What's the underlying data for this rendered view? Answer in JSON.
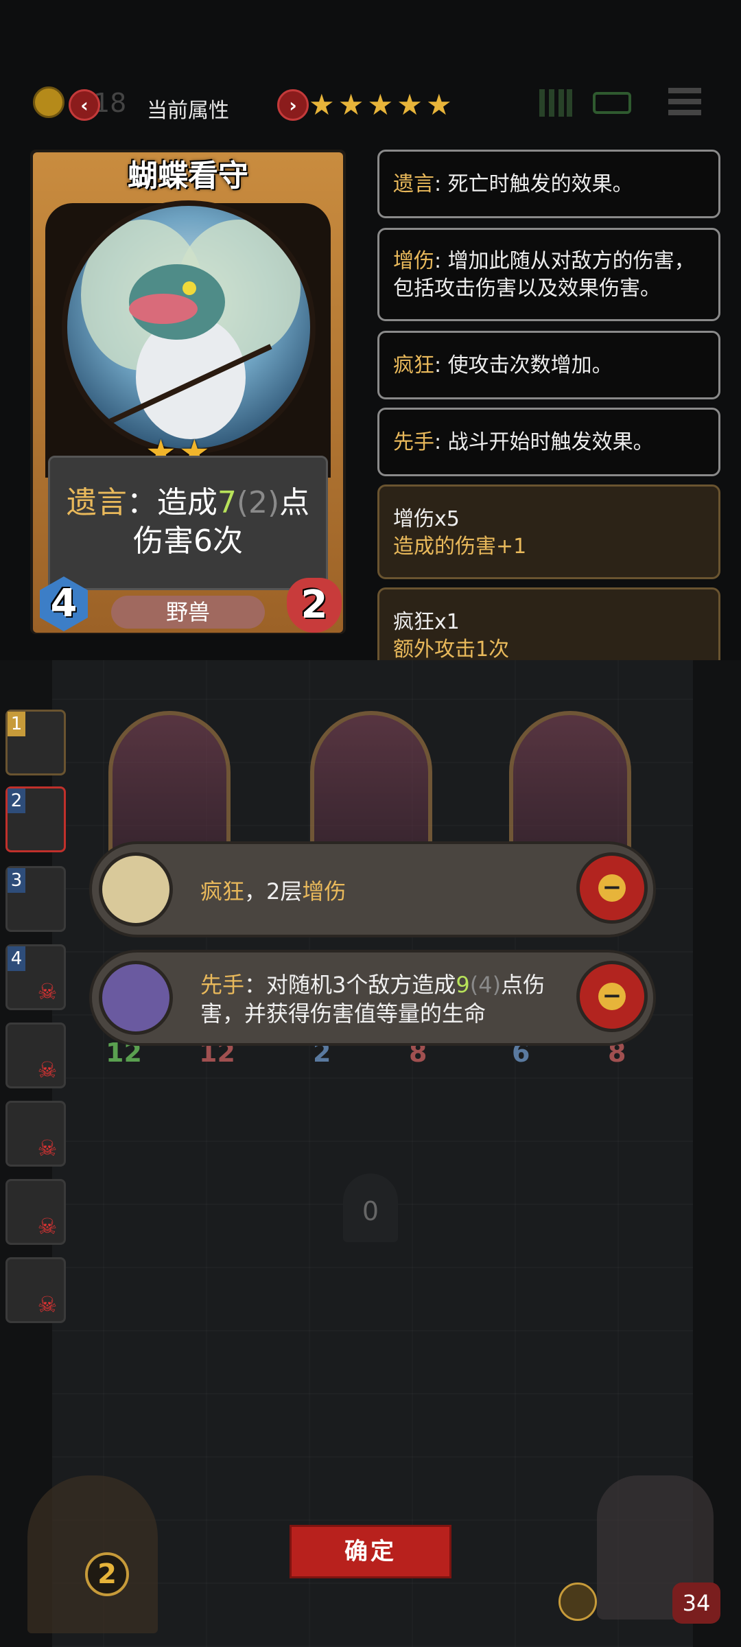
{
  "topbar": {
    "coin_value": "18",
    "section_title": "当前属性",
    "stars_total": 5,
    "stars_on": 5
  },
  "card": {
    "name": "蝴蝶看守",
    "stars": "★★",
    "desc_prefix": "遗言",
    "desc_sep": "：",
    "desc_mid": "造成",
    "desc_value": "7",
    "desc_base": "(2)",
    "desc_unit": "点",
    "desc_line2": "伤害6次",
    "attack": "4",
    "health": "2",
    "tribe": "野兽"
  },
  "keywords": [
    {
      "name": "遗言",
      "text": ": 死亡时触发的效果。"
    },
    {
      "name": "增伤",
      "text": ": 增加此随从对敌方的伤害，包括攻击伤害以及效果伤害。"
    },
    {
      "name": "疯狂",
      "text": ": 使攻击次数增加。"
    },
    {
      "name": "先手",
      "text": ": 战斗开始时触发效果。"
    }
  ],
  "buffs": [
    {
      "title": "增伤x5",
      "detail": "造成的伤害+1"
    },
    {
      "title": "疯狂x1",
      "detail": "额外攻击1次"
    }
  ],
  "side_slots": [
    "1",
    "2",
    "3",
    "4"
  ],
  "board_stats": [
    "12",
    "12",
    "2",
    "8",
    "6",
    "8"
  ],
  "pills": [
    {
      "pre": "疯狂",
      "mid": "，2层",
      "post": "增伤"
    },
    {
      "pre": "先手",
      "mid": "：对随机3个敌方造成",
      "val": "9",
      "base": "(4)",
      "post": "点伤",
      "line2": "害，并获得伤害值等量的生命"
    }
  ],
  "center_counter": "0",
  "confirm_label": "确定",
  "shop_count": "2",
  "player_hp": "34",
  "colors": {
    "accent_gold": "#e9b95b",
    "accent_green": "#b8e35a",
    "confirm_red": "#b8211d"
  }
}
